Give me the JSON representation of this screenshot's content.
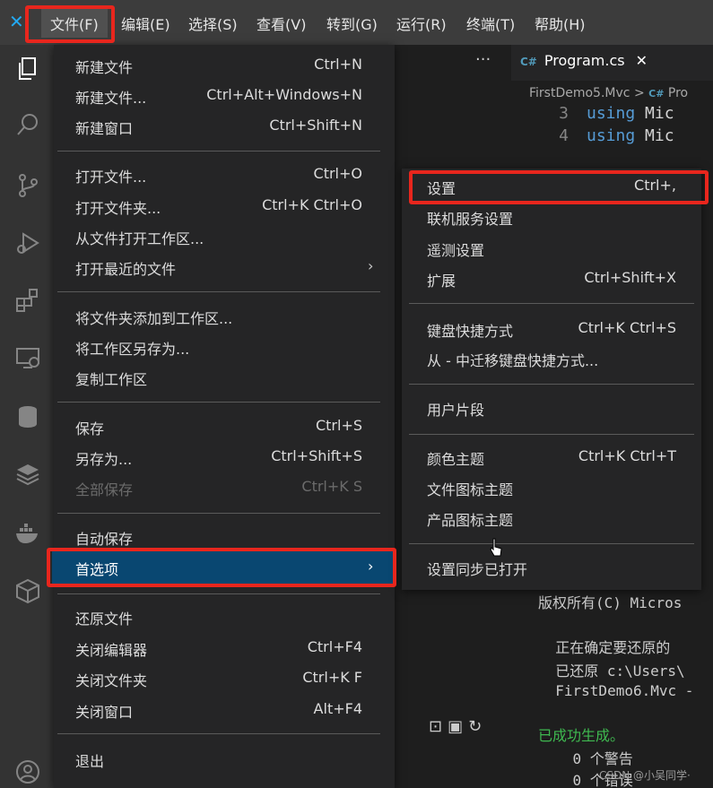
{
  "menubar": {
    "items": [
      "文件(F)",
      "编辑(E)",
      "选择(S)",
      "查看(V)",
      "转到(G)",
      "运行(R)",
      "终端(T)",
      "帮助(H)"
    ]
  },
  "file_menu": {
    "items": [
      {
        "label": "新建文件",
        "shortcut": "Ctrl+N"
      },
      {
        "label": "新建文件...",
        "shortcut": "Ctrl+Alt+Windows+N"
      },
      {
        "label": "新建窗口",
        "shortcut": "Ctrl+Shift+N"
      },
      {
        "label": "打开文件...",
        "shortcut": "Ctrl+O"
      },
      {
        "label": "打开文件夹...",
        "shortcut": "Ctrl+K Ctrl+O"
      },
      {
        "label": "从文件打开工作区...",
        "shortcut": ""
      },
      {
        "label": "打开最近的文件",
        "shortcut": ""
      },
      {
        "label": "将文件夹添加到工作区...",
        "shortcut": ""
      },
      {
        "label": "将工作区另存为...",
        "shortcut": ""
      },
      {
        "label": "复制工作区",
        "shortcut": ""
      },
      {
        "label": "保存",
        "shortcut": "Ctrl+S"
      },
      {
        "label": "另存为...",
        "shortcut": "Ctrl+Shift+S"
      },
      {
        "label": "全部保存",
        "shortcut": "Ctrl+K S"
      },
      {
        "label": "自动保存",
        "shortcut": ""
      },
      {
        "label": "首选项",
        "shortcut": ""
      },
      {
        "label": "还原文件",
        "shortcut": ""
      },
      {
        "label": "关闭编辑器",
        "shortcut": "Ctrl+F4"
      },
      {
        "label": "关闭文件夹",
        "shortcut": "Ctrl+K F"
      },
      {
        "label": "关闭窗口",
        "shortcut": "Alt+F4"
      },
      {
        "label": "退出",
        "shortcut": ""
      }
    ]
  },
  "prefs_menu": {
    "items": [
      {
        "label": "设置",
        "shortcut": "Ctrl+,"
      },
      {
        "label": "联机服务设置",
        "shortcut": ""
      },
      {
        "label": "遥测设置",
        "shortcut": ""
      },
      {
        "label": "扩展",
        "shortcut": "Ctrl+Shift+X"
      },
      {
        "label": "键盘快捷方式",
        "shortcut": "Ctrl+K Ctrl+S"
      },
      {
        "label": "从 - 中迁移键盘快捷方式...",
        "shortcut": ""
      },
      {
        "label": "用户片段",
        "shortcut": ""
      },
      {
        "label": "颜色主题",
        "shortcut": "Ctrl+K Ctrl+T"
      },
      {
        "label": "文件图标主题",
        "shortcut": ""
      },
      {
        "label": "产品图标主题",
        "shortcut": ""
      },
      {
        "label": "设置同步已打开",
        "shortcut": ""
      }
    ]
  },
  "editor": {
    "tab_label": "Program.cs",
    "tab_lang": "C#",
    "breadcrumb_folder": "FirstDemo5.Mvc",
    "breadcrumb_sep": ">",
    "breadcrumb_file": "Pro",
    "code_lines": [
      {
        "num": "3",
        "kw": "using",
        "rest": " Mic"
      },
      {
        "num": "4",
        "kw": "using",
        "rest": " Mic"
      }
    ]
  },
  "terminal": {
    "lines": [
      "版权所有(C) Micros",
      "  正在确定要还原的",
      "  已还原 c:\\Users\\",
      "  FirstDemo6.Mvc -",
      "已成功生成。",
      "    0 个警告",
      "    0 个错误"
    ]
  },
  "watermark": "CSDN @小吴同学·",
  "colors": {
    "accent_red": "#e8261d",
    "selection": "#094771",
    "menu_bg": "#252526"
  }
}
